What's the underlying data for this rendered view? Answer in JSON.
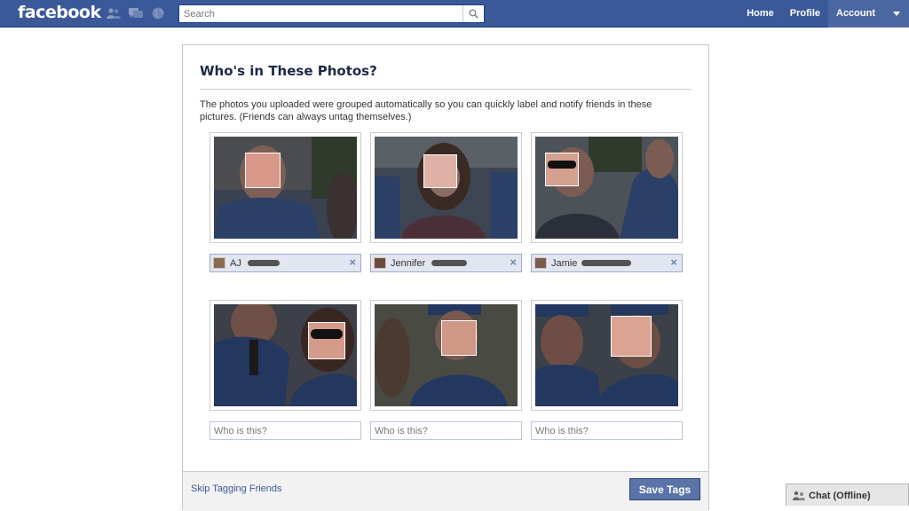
{
  "topbar": {
    "logo": "facebook",
    "search_placeholder": "Search",
    "nav": [
      "Home",
      "Profile",
      "Account"
    ]
  },
  "dialog": {
    "title": "Who's in These Photos?",
    "description": "The photos you uploaded were grouped automatically so you can quickly label and notify friends in these pictures. (Friends can always untag themselves.)",
    "tagged": [
      {
        "name": "AJ"
      },
      {
        "name": "Jennifer"
      },
      {
        "name": "Jamie"
      }
    ],
    "untagged_placeholder": "Who is this?",
    "skip_label": "Skip Tagging Friends",
    "save_label": "Save Tags"
  },
  "chat": {
    "label": "Chat (Offline)"
  },
  "colors": {
    "brand": "#3b5998",
    "link": "#3b5998",
    "tag_chip_bg": "#e2e6f0",
    "save_button": "#5b74a8"
  }
}
